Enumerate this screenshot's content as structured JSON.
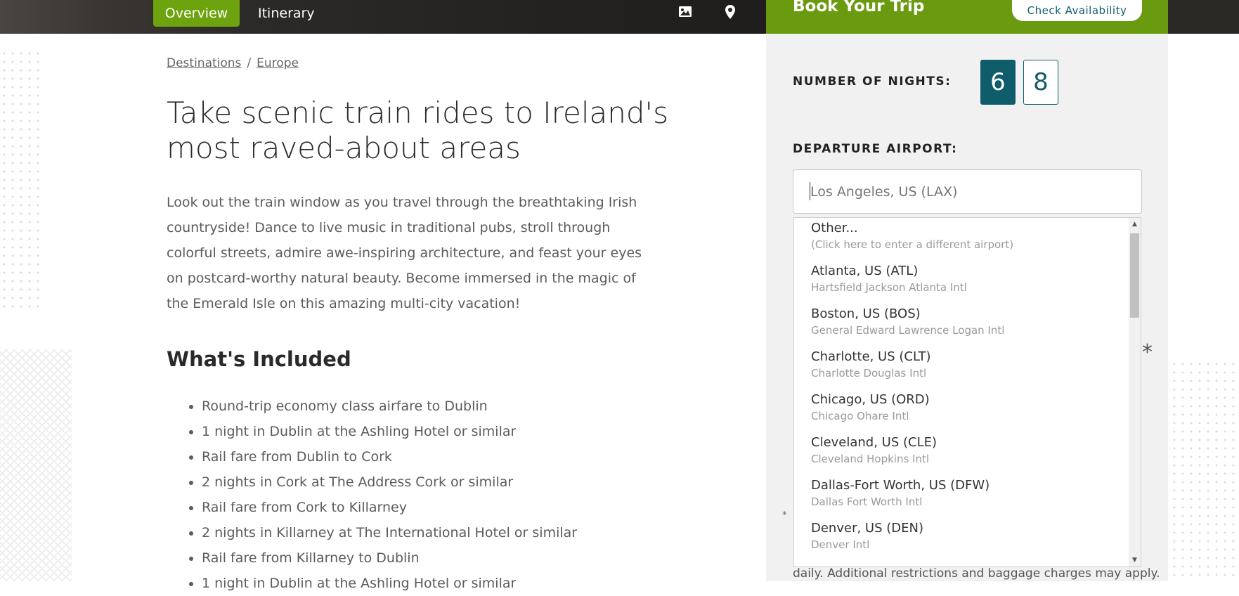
{
  "nav": {
    "overview_label": "Overview",
    "itinerary_label": "Itinerary"
  },
  "booking": {
    "title": "Book Your Trip",
    "check_label": "Check Availability",
    "nights_label": "NUMBER OF NIGHTS:",
    "nights_options": [
      "6",
      "8"
    ],
    "nights_selected": "6",
    "airport_label": "DEPARTURE AIRPORT:",
    "airport_placeholder": "Los Angeles, US (LAX)",
    "asterisk": "*",
    "small_asterisk": "*",
    "footnote": "daily. Additional restrictions and baggage charges may apply."
  },
  "airports": [
    {
      "name": "Other...",
      "sub": "(Click here to enter a different airport)"
    },
    {
      "name": "Atlanta, US (ATL)",
      "sub": "Hartsfield Jackson Atlanta Intl"
    },
    {
      "name": "Boston, US (BOS)",
      "sub": "General Edward Lawrence Logan Intl"
    },
    {
      "name": "Charlotte, US (CLT)",
      "sub": "Charlotte Douglas Intl"
    },
    {
      "name": "Chicago, US (ORD)",
      "sub": "Chicago Ohare Intl"
    },
    {
      "name": "Cleveland, US (CLE)",
      "sub": "Cleveland Hopkins Intl"
    },
    {
      "name": "Dallas-Fort Worth, US (DFW)",
      "sub": "Dallas Fort Worth Intl"
    },
    {
      "name": "Denver, US (DEN)",
      "sub": "Denver Intl"
    }
  ],
  "breadcrumb": {
    "items": [
      "Destinations",
      "Europe"
    ],
    "separator": "/"
  },
  "content": {
    "title": "Take scenic train rides to Ireland's most raved-about areas",
    "intro": "Look out the train window as you travel through the breathtaking Irish countryside! Dance to live music in traditional pubs, stroll through colorful streets, admire awe-inspiring architecture, and feast your eyes on postcard-worthy natural beauty. Become immersed in the magic of the Emerald Isle on this amazing multi-city vacation!",
    "included_title": "What's Included",
    "included": [
      "Round-trip economy class airfare to Dublin",
      "1 night in Dublin at the Ashling Hotel or similar",
      "Rail fare from Dublin to Cork",
      "2 nights in Cork at The Address Cork or similar",
      "Rail fare from Cork to Killarney",
      "2 nights in Killarney at The International Hotel or similar",
      "Rail fare from Killarney to Dublin",
      "1 night in Dublin at the Ashling Hotel or similar"
    ]
  },
  "colors": {
    "accent_green": "#6da30f",
    "teal": "#0f5c6b"
  }
}
